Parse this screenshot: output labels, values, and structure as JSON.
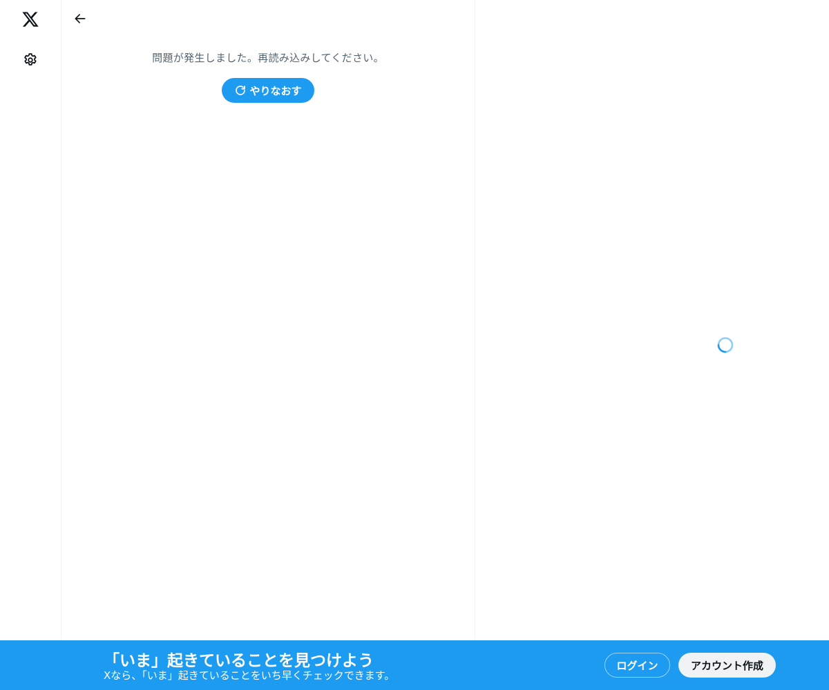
{
  "nav": {
    "logo_icon": "x-logo-icon",
    "settings_icon": "gear-icon"
  },
  "primary": {
    "back_icon": "arrow-left-icon",
    "error_message": "問題が発生しました。再読み込みしてください。",
    "retry_label": "やりなおす",
    "retry_icon": "refresh-icon"
  },
  "sidebar": {
    "loading_icon": "loading-spinner-icon"
  },
  "bottom_bar": {
    "title": "「いま」起きていることを見つけよう",
    "subtitle": "Xなら、「いま」起きていることをいち早くチェックできます。",
    "login_label": "ログイン",
    "signup_label": "アカウント作成"
  },
  "colors": {
    "accent": "#1d9bf0",
    "text_primary": "#0f1419",
    "text_secondary": "#536471",
    "border": "#eff3f4"
  }
}
